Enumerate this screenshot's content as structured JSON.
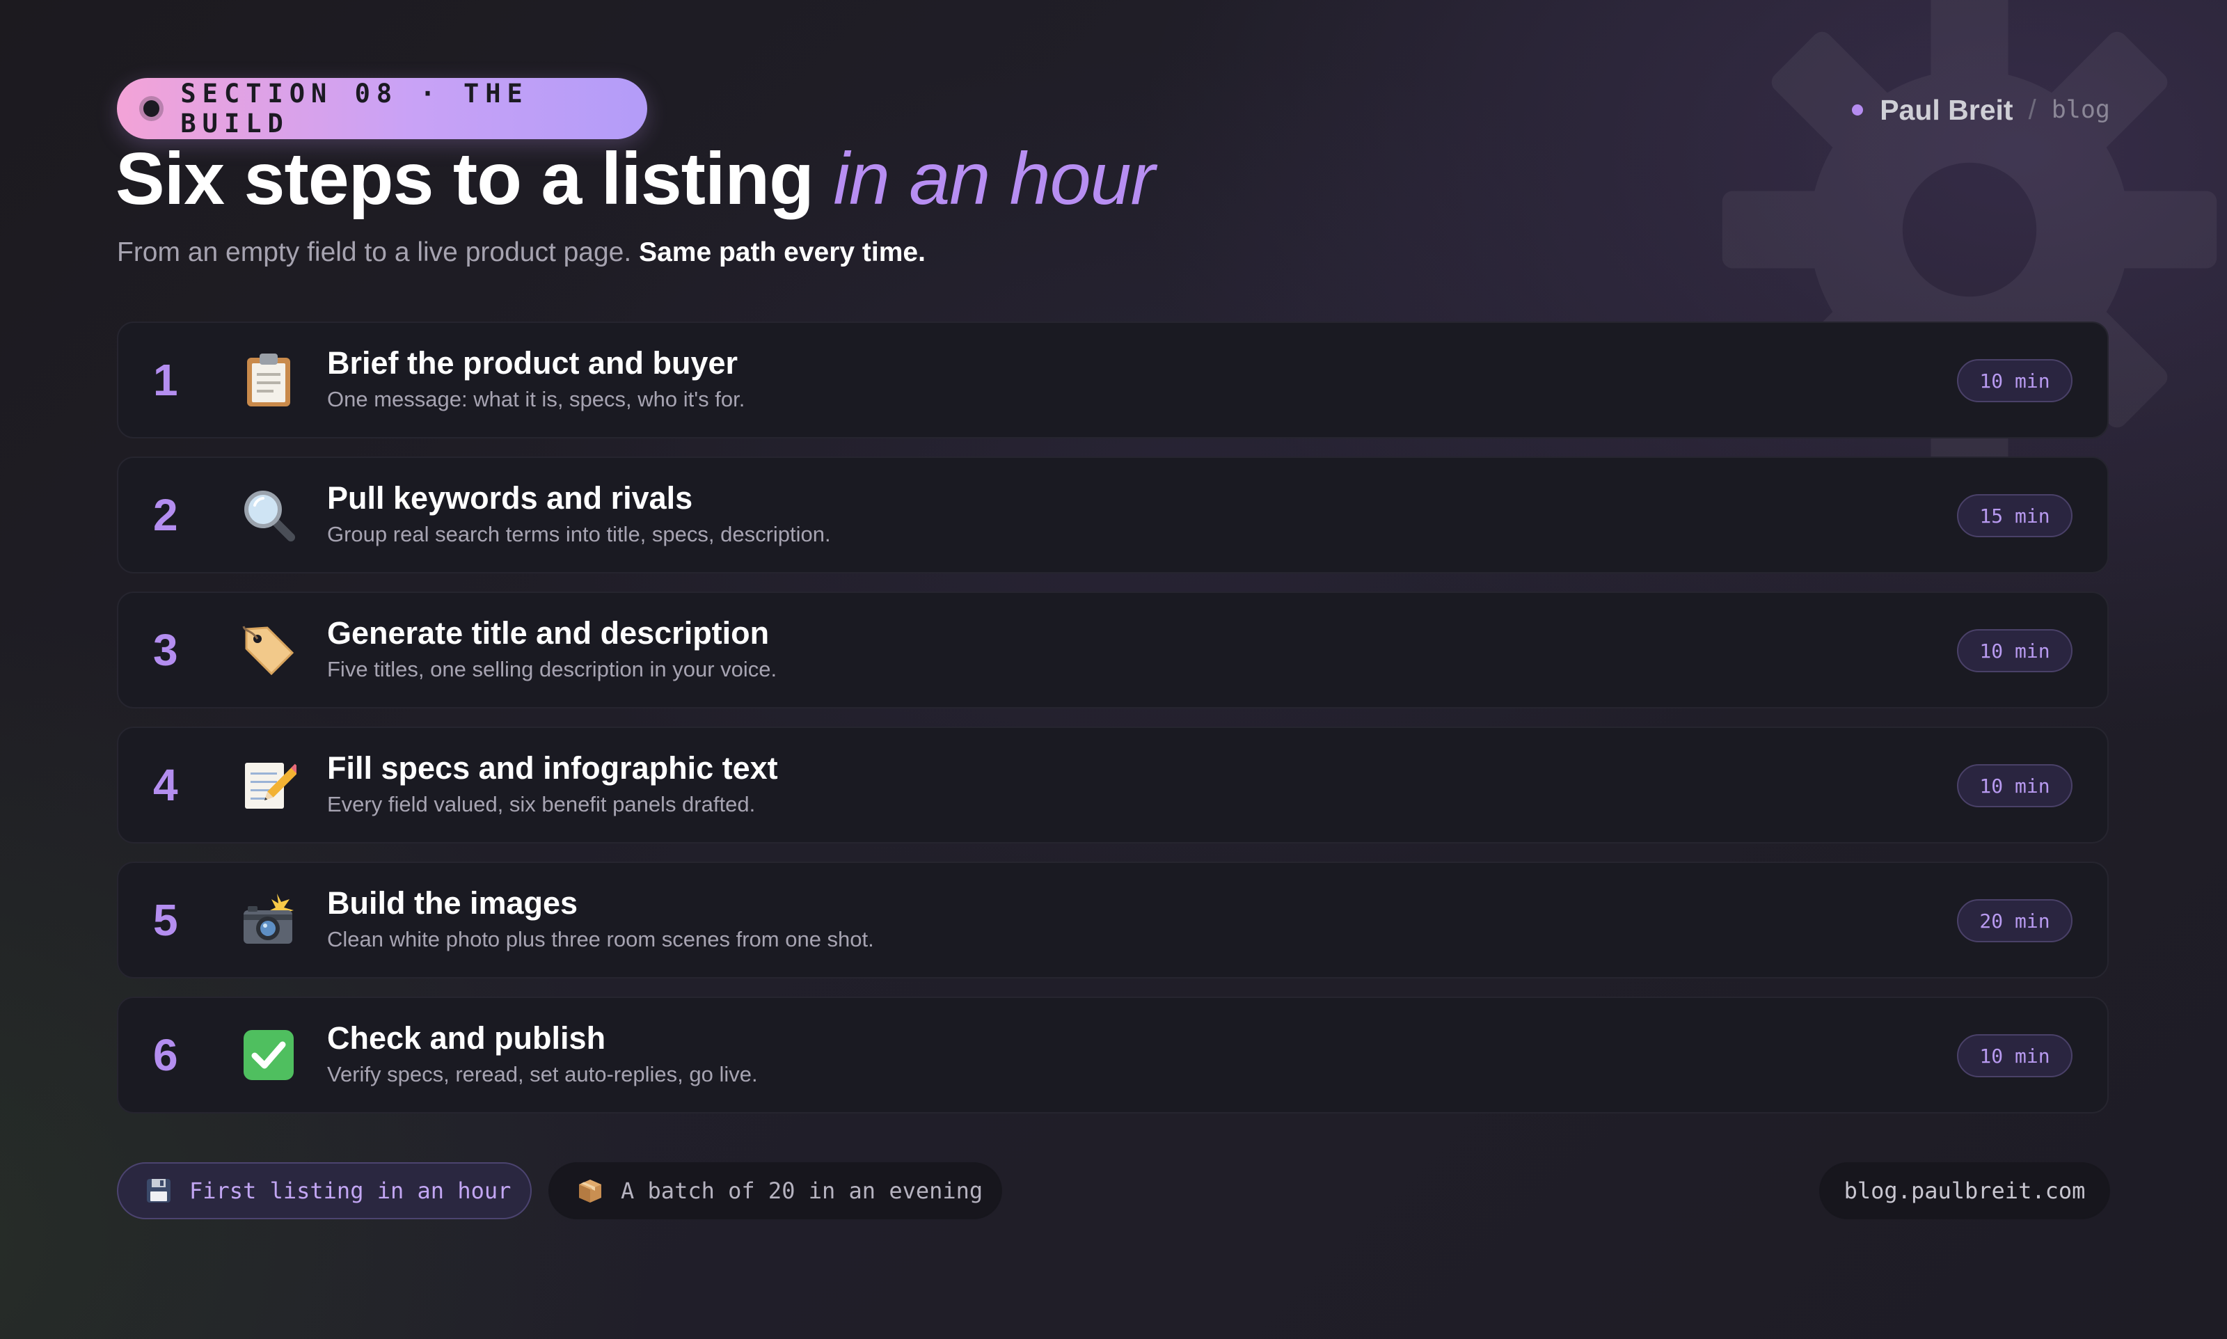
{
  "header": {
    "badge": "SECTION 08 · THE BUILD",
    "title_main": "Six steps to a listing",
    "title_accent": "in an hour",
    "subtitle_plain": "From an empty field to a live product page.",
    "subtitle_strong": "Same path every time.",
    "author": "Paul Breit",
    "separator": "/",
    "section": "blog"
  },
  "steps": [
    {
      "number": "1",
      "icon": "clipboard-icon",
      "title": "Brief the product and buyer",
      "description": "One message: what it is, specs, who it's for.",
      "time": "10 min"
    },
    {
      "number": "2",
      "icon": "magnifier-icon",
      "title": "Pull keywords and rivals",
      "description": "Group real search terms into title, specs, description.",
      "time": "15 min"
    },
    {
      "number": "3",
      "icon": "tag-icon",
      "title": "Generate title and description",
      "description": "Five titles, one selling description in your voice.",
      "time": "10 min"
    },
    {
      "number": "4",
      "icon": "memo-icon",
      "title": "Fill specs and infographic text",
      "description": "Every field valued, six benefit panels drafted.",
      "time": "10 min"
    },
    {
      "number": "5",
      "icon": "camera-flash-icon",
      "title": "Build the images",
      "description": "Clean white photo plus three room scenes from one shot.",
      "time": "20 min"
    },
    {
      "number": "6",
      "icon": "check-mark-icon",
      "title": "Check and publish",
      "description": "Verify specs, reread, set auto-replies, go live.",
      "time": "10 min"
    }
  ],
  "footer": {
    "pill_first": {
      "icon": "floppy-disk-icon",
      "label": "First listing in an hour"
    },
    "pill_batch": {
      "icon": "package-icon",
      "label": "A batch of 20 in an evening"
    },
    "site": "blog.paulbreit.com"
  },
  "colors": {
    "accent": "#b78ef2",
    "badge_gradient_start": "#f3a3d7",
    "badge_gradient_end": "#b39cf8",
    "card_background": "#1a1a22",
    "check_green": "#4fbf5f"
  }
}
